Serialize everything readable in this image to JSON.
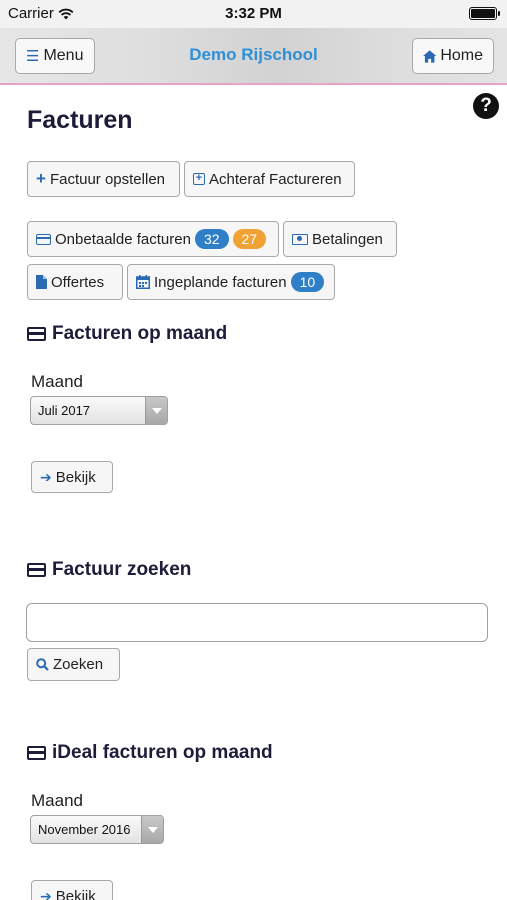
{
  "status_bar": {
    "carrier": "Carrier",
    "time": "3:32 PM",
    "battery_level": 1.0
  },
  "header": {
    "menu_label": "Menu",
    "title": "Demo Rijschool",
    "home_label": "Home",
    "accent_color": "#2e8fd6"
  },
  "help": {
    "symbol": "?"
  },
  "page": {
    "title": "Facturen"
  },
  "actions": {
    "create_invoice": "Factuur opstellen",
    "invoice_afterwards": "Achteraf Factureren"
  },
  "tabs": {
    "unpaid": {
      "label": "Onbetaalde facturen",
      "badge_blue": "32",
      "badge_orange": "27"
    },
    "payments": {
      "label": "Betalingen"
    },
    "quotes": {
      "label": "Offertes"
    },
    "scheduled": {
      "label": "Ingeplande facturen",
      "badge": "10"
    }
  },
  "monthly": {
    "title": "Facturen op maand",
    "month_label": "Maand",
    "month_value": "Juli 2017",
    "view_button": "Bekijk"
  },
  "search": {
    "title": "Factuur zoeken",
    "input_value": "",
    "search_button": "Zoeken"
  },
  "ideal": {
    "title": "iDeal facturen op maand",
    "month_label": "Maand",
    "month_value": "November 2016",
    "view_button": "Bekijk"
  },
  "icons": [
    "wifi-icon",
    "bars-icon",
    "home-icon",
    "plus-icon",
    "plus-square-icon",
    "credit-card-icon",
    "money-icon",
    "file-icon",
    "calendar-icon",
    "arrow-right-icon",
    "search-icon",
    "question-circle-icon"
  ],
  "colors": {
    "badge_blue": "#2e7fc7",
    "badge_orange": "#f0a234",
    "header_border": "#e7a3c4",
    "icon_blue": "#2a6ab3"
  }
}
